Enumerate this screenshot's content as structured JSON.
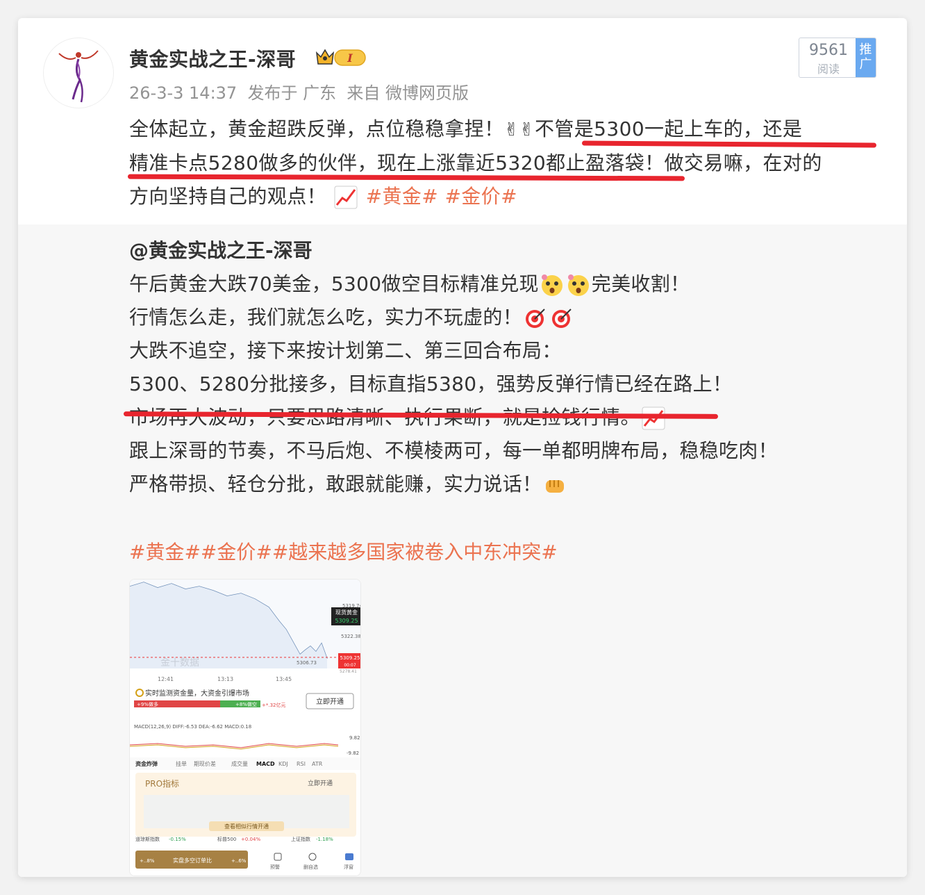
{
  "post": {
    "username": "黄金实战之王-深哥",
    "vip_level": "I",
    "meta": "26-3-3 14:37  发布于 广东  来自 微博网页版",
    "reads_count": "9561",
    "reads_label": "阅读",
    "promo_tag": "推广",
    "content_line1_a": "全体起立，黄金超跌反弹，点位稳稳拿捏！",
    "content_line1_b": "不管是5300一起上车的，还是",
    "content_line2_a": "精准卡点5280做多的伙伴，现在上涨靠近5320都止盈落袋！",
    "content_line2_b": "做交易嘛，在对的",
    "content_line3": "方向坚持自己的观点！",
    "topics": "#黄金# #金价#"
  },
  "repost": {
    "username": "@黄金实战之王-深哥",
    "lines": [
      "午后黄金大跌70美金，5300做空目标精准兑现",
      "完美收割！",
      "行情怎么走，我们就怎么吃，实力不玩虚的！",
      "大跌不追空，接下来按计划第二、第三回合布局：",
      "5300、5280分批接多，目标直指5380，强势反弹行情已经在路上！",
      "市场再大波动，只要思路清晰、执行果断，就是捡钱行情。",
      "跟上深哥的节奏，不马后炮、不模棱两可，每一单都明牌布局，稳稳吃肉！",
      "严格带损、轻仓分批，敢跟就能赚，实力说话！"
    ],
    "topics": "#黄金##金价##越来越多国家被卷入中东冲突#"
  },
  "screenshot": {
    "price_labels": [
      "5319.74",
      "5322.38",
      "5309.25",
      "5306.73",
      "5278.41"
    ],
    "spot_label": "现货黄金",
    "spot_price": "5309.25",
    "badge_sub": "00:07",
    "times": [
      "12:41",
      "13:13",
      "13:45"
    ],
    "watermark": "金十数据",
    "monitor_text": "实时监测资金量，大资金引爆市场",
    "bull_text": "+9%做多",
    "bear_text": "+8%做空",
    "amount_text": "+*.32亿元",
    "open_button": "立即开通",
    "macd_text": "MACD(12,26,9)  DIFF:-6.53  DEA:-6.62  MACD:0.18",
    "macd_hi": "9.82",
    "macd_lo": "-9.82",
    "tabs": [
      "资金炸弹",
      "挂单",
      "期现价差",
      "成交量",
      "MACD",
      "KDJ",
      "RSI",
      "ATR"
    ],
    "pro_label": "PRO指标",
    "pro_open": "立即开通",
    "pro_banner": "查看相似行情开通",
    "indices": [
      {
        "name": "道琼斯指数",
        "value": "-0.15%"
      },
      {
        "name": "标普500",
        "value": "+0.04%"
      },
      {
        "name": "上证指数",
        "value": "-1.18%"
      }
    ],
    "bottom_bar": "实盘多空订单比",
    "bottom_pct_left": "+..8%",
    "bottom_pct_right": "+..6%",
    "bottom_nav": [
      "预警",
      "删自选",
      "浮窗"
    ]
  },
  "colors": {
    "topic": "#eb7350",
    "underline": "#e8252e",
    "text": "#333333",
    "meta": "#939393",
    "promo": "#6aa9f0"
  }
}
